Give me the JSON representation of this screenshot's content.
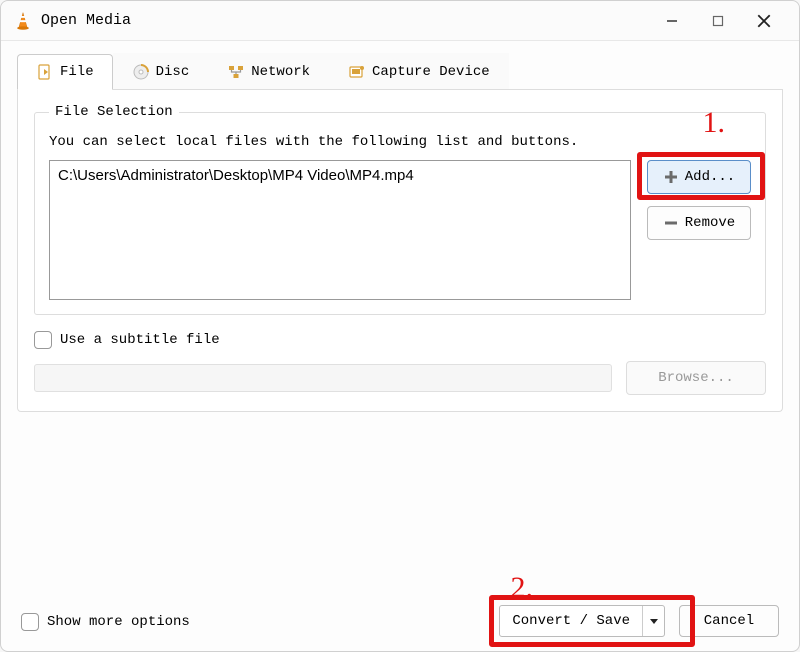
{
  "window": {
    "title": "Open Media"
  },
  "tabs": {
    "file": "File",
    "disc": "Disc",
    "network": "Network",
    "capture": "Capture Device"
  },
  "file_selection": {
    "legend": "File Selection",
    "hint": "You can select local files with the following list and buttons.",
    "files": [
      "C:\\Users\\Administrator\\Desktop\\MP4 Video\\MP4.mp4"
    ],
    "add_label": "Add...",
    "remove_label": "Remove"
  },
  "subtitle": {
    "checkbox_label": "Use a subtitle file",
    "browse_label": "Browse..."
  },
  "show_more_label": "Show more options",
  "actions": {
    "convert_label": "Convert / Save",
    "cancel_label": "Cancel"
  },
  "annotations": {
    "one": "1.",
    "two": "2."
  }
}
